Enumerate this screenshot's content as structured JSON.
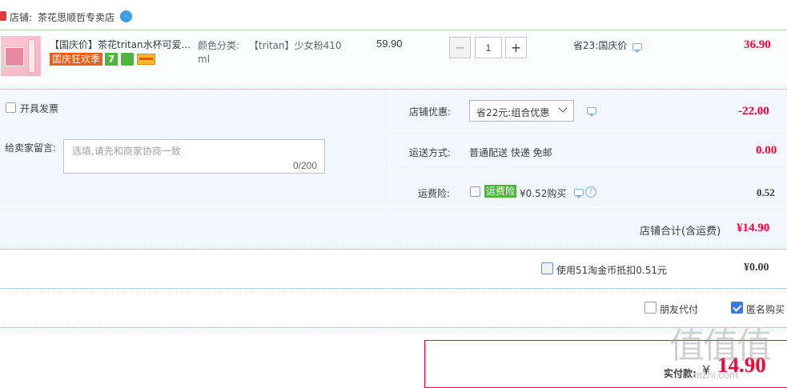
{
  "shop": {
    "label": "店铺:",
    "name": "茶花思顺哲专卖店",
    "shop_icon": "shop-icon",
    "wangwang_icon": "wangwang-chat-icon"
  },
  "item": {
    "title": "【国庆价】茶花tritan水杯可爱...",
    "badge_promo": "国庆狂欢季",
    "badge_seven": "7",
    "sku_label": "颜色分类:",
    "sku_value_line1": "【tritan】少女粉410",
    "sku_value_line2": "ml",
    "unit_price": "59.90",
    "quantity": "1",
    "minus_label": "−",
    "plus_label": "+",
    "discount": "省23:国庆价",
    "subtotal": "36.90"
  },
  "invoice": {
    "label": "开具发票"
  },
  "message": {
    "label": "给卖家留言:",
    "placeholder": "选填,请先和商家协商一致",
    "counter": "0/200"
  },
  "shop_discount": {
    "label": "店铺优惠:",
    "selected": "省22元:组合优惠",
    "amount": "-22.00"
  },
  "shipping": {
    "label": "运送方式:",
    "value": "普通配送 快递 免邮",
    "amount": "0.00"
  },
  "freight_insurance": {
    "label": "运费险:",
    "badge": "运费险",
    "price": "¥0.52购买",
    "help": "?",
    "amount": "0.52"
  },
  "shop_total": {
    "label": "店铺合计(含运费)",
    "amount": "¥14.90"
  },
  "coins": {
    "label": "使用51淘金币抵扣0.51元",
    "amount": "¥0.00"
  },
  "options": {
    "friend_pay": "朋友代付",
    "anonymous": "匿名购买"
  },
  "pay": {
    "label": "实付款:",
    "currency": "¥",
    "amount": "14.90"
  },
  "watermark": {
    "text": "值值值",
    "url": "zhi.mzhi.com"
  },
  "colors": {
    "accent_red": "#ff0036",
    "panel_blue": "#f2f7ff",
    "badge_green": "#4fb53c",
    "badge_orange": "#f25c12"
  }
}
